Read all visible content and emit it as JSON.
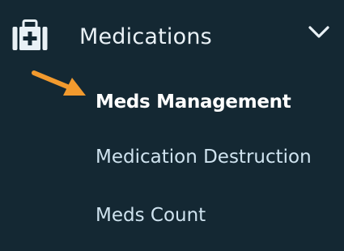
{
  "menu": {
    "section_label": "Medications",
    "section_icon": "medkit-icon",
    "expanded": true,
    "items": [
      {
        "label": "Meds Management",
        "active": true
      },
      {
        "label": "Medication Destruction",
        "active": false
      },
      {
        "label": "Meds Count",
        "active": false
      }
    ]
  },
  "colors": {
    "background": "#142833",
    "text": "#e9f1f6",
    "submenu_text": "#cfe3ef",
    "active_text": "#ffffff",
    "pointer_arrow": "#f29a2e"
  }
}
